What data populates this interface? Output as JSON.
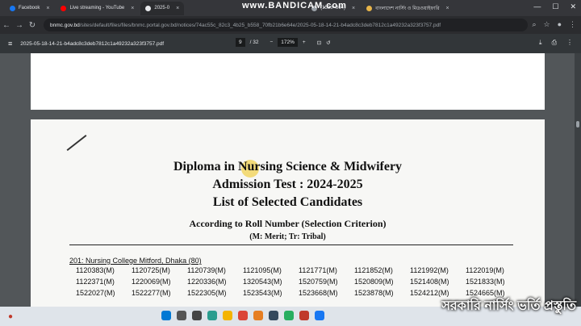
{
  "browser": {
    "tabs": [
      {
        "label": "Facebook",
        "color": "#1877f2"
      },
      {
        "label": "Live streaming - YouTube",
        "color": "#ff0000"
      },
      {
        "label": "2025-0",
        "color": "#e8eaed",
        "active": true
      },
      {
        "label": "(1536×864)",
        "color": "#9aa0a6"
      },
      {
        "label": "বাংলাদেশ নার্সিং ও মিডওয়াইফারি",
        "color": "#e8b54a"
      }
    ],
    "watermark": "www.BANDICAM.com",
    "url_host": "bnmc.gov.bd",
    "url_path": "/sites/default/files/files/bnmc.portal.gov.bd/notices/74ac55c_82c3_4b25_b558_70fb21b6e64e/2025-05-18-14-21-b4adc8c3deb7812c1a49232a323f3757.pdf"
  },
  "pdf": {
    "title": "2025-05-18-14-21-b4adc8c3deb7812c1a49232a323f3757.pdf",
    "page_current": "9",
    "page_total": "/ 32",
    "zoom": "172%"
  },
  "document": {
    "line1": "Diploma in Nursing Science & Midwifery",
    "line2": "Admission Test : 2024-2025",
    "line3": "List of Selected Candidates",
    "line4": "According to Roll Number (Selection Criterion)",
    "line5": "(M: Merit; Tr: Tribal)",
    "section": "201: Nursing College Mitford, Dhaka (80)",
    "rows": [
      [
        "1120383(M)",
        "1120725(M)",
        "1120739(M)",
        "1121095(M)",
        "1121771(M)",
        "1121852(M)",
        "1121992(M)",
        "1122019(M)"
      ],
      [
        "1122371(M)",
        "1220069(M)",
        "1220336(M)",
        "1320543(M)",
        "1520759(M)",
        "1520809(M)",
        "1521408(M)",
        "1521833(M)"
      ],
      [
        "1522027(M)",
        "1522277(M)",
        "1522305(M)",
        "1523543(M)",
        "1523668(M)",
        "1523878(M)",
        "1524212(M)",
        "1524665(M)"
      ]
    ]
  },
  "overlay_caption": "সরকারি নার্সিং ভর্তি প্রস্তুতি"
}
